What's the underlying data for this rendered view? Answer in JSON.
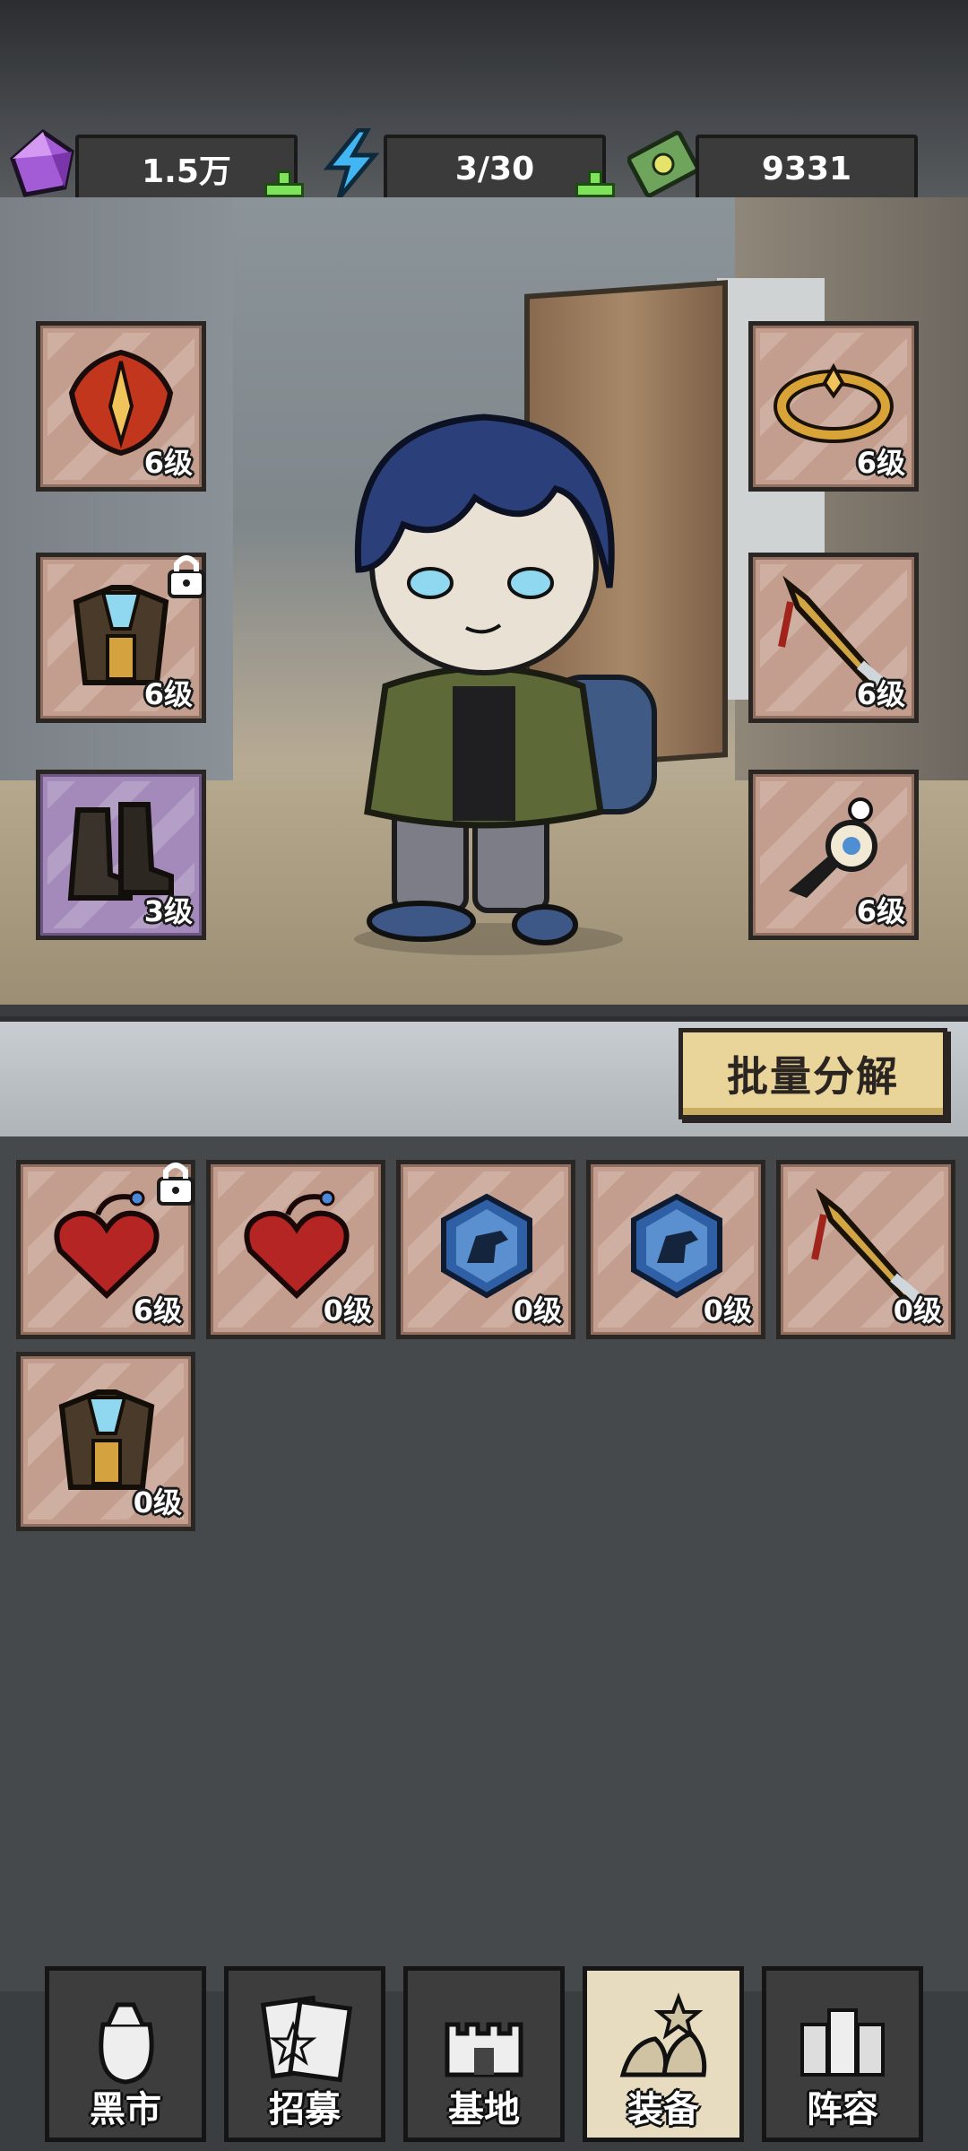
{
  "resources": {
    "gems": "1.5万",
    "energy": "3/30",
    "cash": "9331"
  },
  "equipped": {
    "left": [
      {
        "name": "helmet",
        "level": "6级",
        "locked": false
      },
      {
        "name": "armor",
        "level": "6级",
        "locked": true
      },
      {
        "name": "boots",
        "level": "3级",
        "locked": false
      }
    ],
    "right": [
      {
        "name": "ring",
        "level": "6级",
        "locked": false
      },
      {
        "name": "weapon",
        "level": "6级",
        "locked": false
      },
      {
        "name": "amulet",
        "level": "6级",
        "locked": false
      }
    ]
  },
  "batch_button": "批量分解",
  "inventory": [
    {
      "name": "heart-charm",
      "level": "6级",
      "locked": true
    },
    {
      "name": "heart-charm",
      "level": "0级",
      "locked": false
    },
    {
      "name": "dino-badge",
      "level": "0级",
      "locked": false
    },
    {
      "name": "dino-badge",
      "level": "0级",
      "locked": false
    },
    {
      "name": "weapon",
      "level": "0级",
      "locked": false
    },
    {
      "name": "armor",
      "level": "0级",
      "locked": false
    }
  ],
  "nav": [
    {
      "label": "黑市",
      "active": false
    },
    {
      "label": "招募",
      "active": false
    },
    {
      "label": "基地",
      "active": false
    },
    {
      "label": "装备",
      "active": true
    },
    {
      "label": "阵容",
      "active": false
    }
  ],
  "colors": {
    "slot_bg": "#c39e8e",
    "slot_purple": "#a48aba",
    "plus_green": "#7ee35a",
    "button_yellow": "#e9d59a"
  }
}
